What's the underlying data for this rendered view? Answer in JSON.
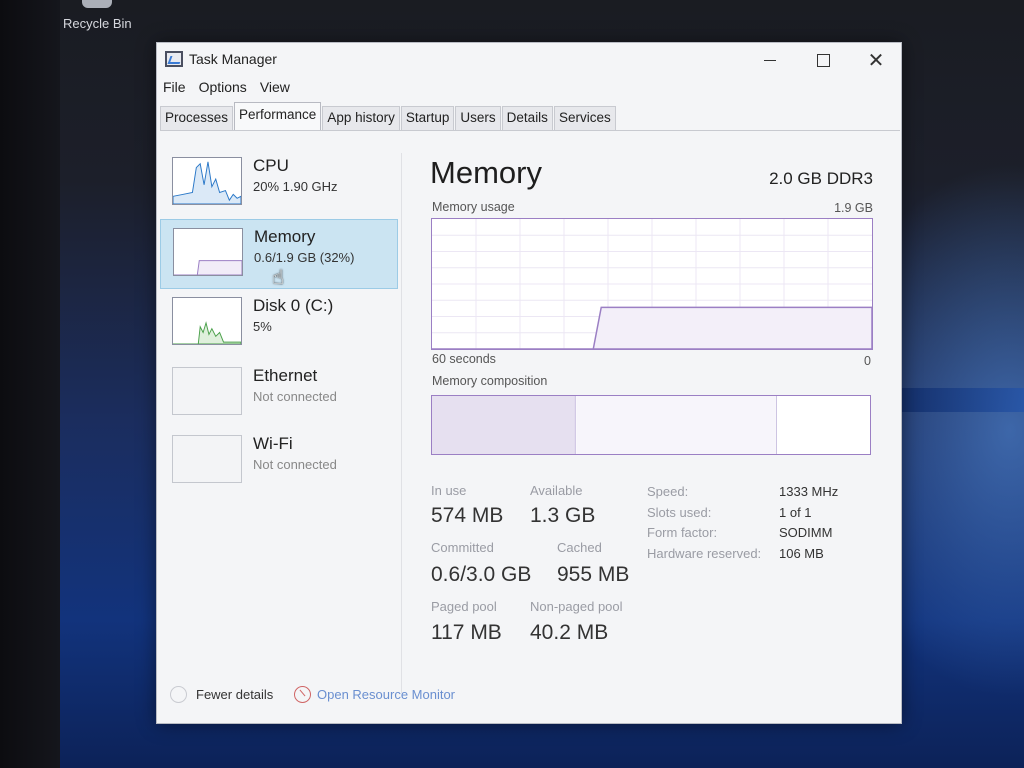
{
  "desktop": {
    "recycle_bin_label": "Recycle Bin"
  },
  "window": {
    "title": "Task Manager",
    "controls": {
      "minimize": "",
      "maximize": "",
      "close": "✕"
    }
  },
  "menu": [
    "File",
    "Options",
    "View"
  ],
  "tabs": [
    {
      "label": "Processes",
      "active": false
    },
    {
      "label": "Performance",
      "active": true
    },
    {
      "label": "App history",
      "active": false
    },
    {
      "label": "Startup",
      "active": false
    },
    {
      "label": "Users",
      "active": false
    },
    {
      "label": "Details",
      "active": false
    },
    {
      "label": "Services",
      "active": false
    }
  ],
  "sidebar": {
    "items": [
      {
        "name": "CPU",
        "sub": "20%  1.90 GHz",
        "selected": false
      },
      {
        "name": "Memory",
        "sub": "0.6/1.9 GB (32%)",
        "selected": true
      },
      {
        "name": "Disk 0 (C:)",
        "sub": "5%",
        "selected": false
      },
      {
        "name": "Ethernet",
        "sub": "Not connected",
        "selected": false
      },
      {
        "name": "Wi-Fi",
        "sub": "Not connected",
        "selected": false
      }
    ]
  },
  "memory": {
    "title": "Memory",
    "spec": "2.0 GB DDR3",
    "usage_label": "Memory usage",
    "usage_max": "1.9 GB",
    "time_left": "60 seconds",
    "time_right": "0",
    "composition_label": "Memory composition",
    "usage_level_fraction": 0.32,
    "stats": {
      "in_use_label": "In use",
      "in_use": "574 MB",
      "available_label": "Available",
      "available": "1.3 GB",
      "committed_label": "Committed",
      "committed": "0.6/3.0 GB",
      "cached_label": "Cached",
      "cached": "955 MB",
      "paged_label": "Paged pool",
      "paged": "117 MB",
      "nonpaged_label": "Non-paged pool",
      "nonpaged": "40.2 MB"
    },
    "specs": {
      "speed_label": "Speed:",
      "speed": "1333 MHz",
      "slots_label": "Slots used:",
      "slots": "1 of 1",
      "form_label": "Form factor:",
      "form": "SODIMM",
      "reserved_label": "Hardware reserved:",
      "reserved": "106 MB"
    }
  },
  "footer": {
    "fewer_details": "Fewer details",
    "open_resource_monitor": "Open Resource Monitor"
  },
  "colors": {
    "memory_accent": "#9b7fc4",
    "cpu_graph": "#2a78c8",
    "disk_graph": "#4aa04a",
    "selection": "#cbe4f2",
    "link": "#6a8fd0"
  },
  "icons": {
    "app": "task-manager-icon",
    "fewer": "chevron-up-icon",
    "resmon": "resource-monitor-icon",
    "cursor": "hand-pointer-icon"
  }
}
